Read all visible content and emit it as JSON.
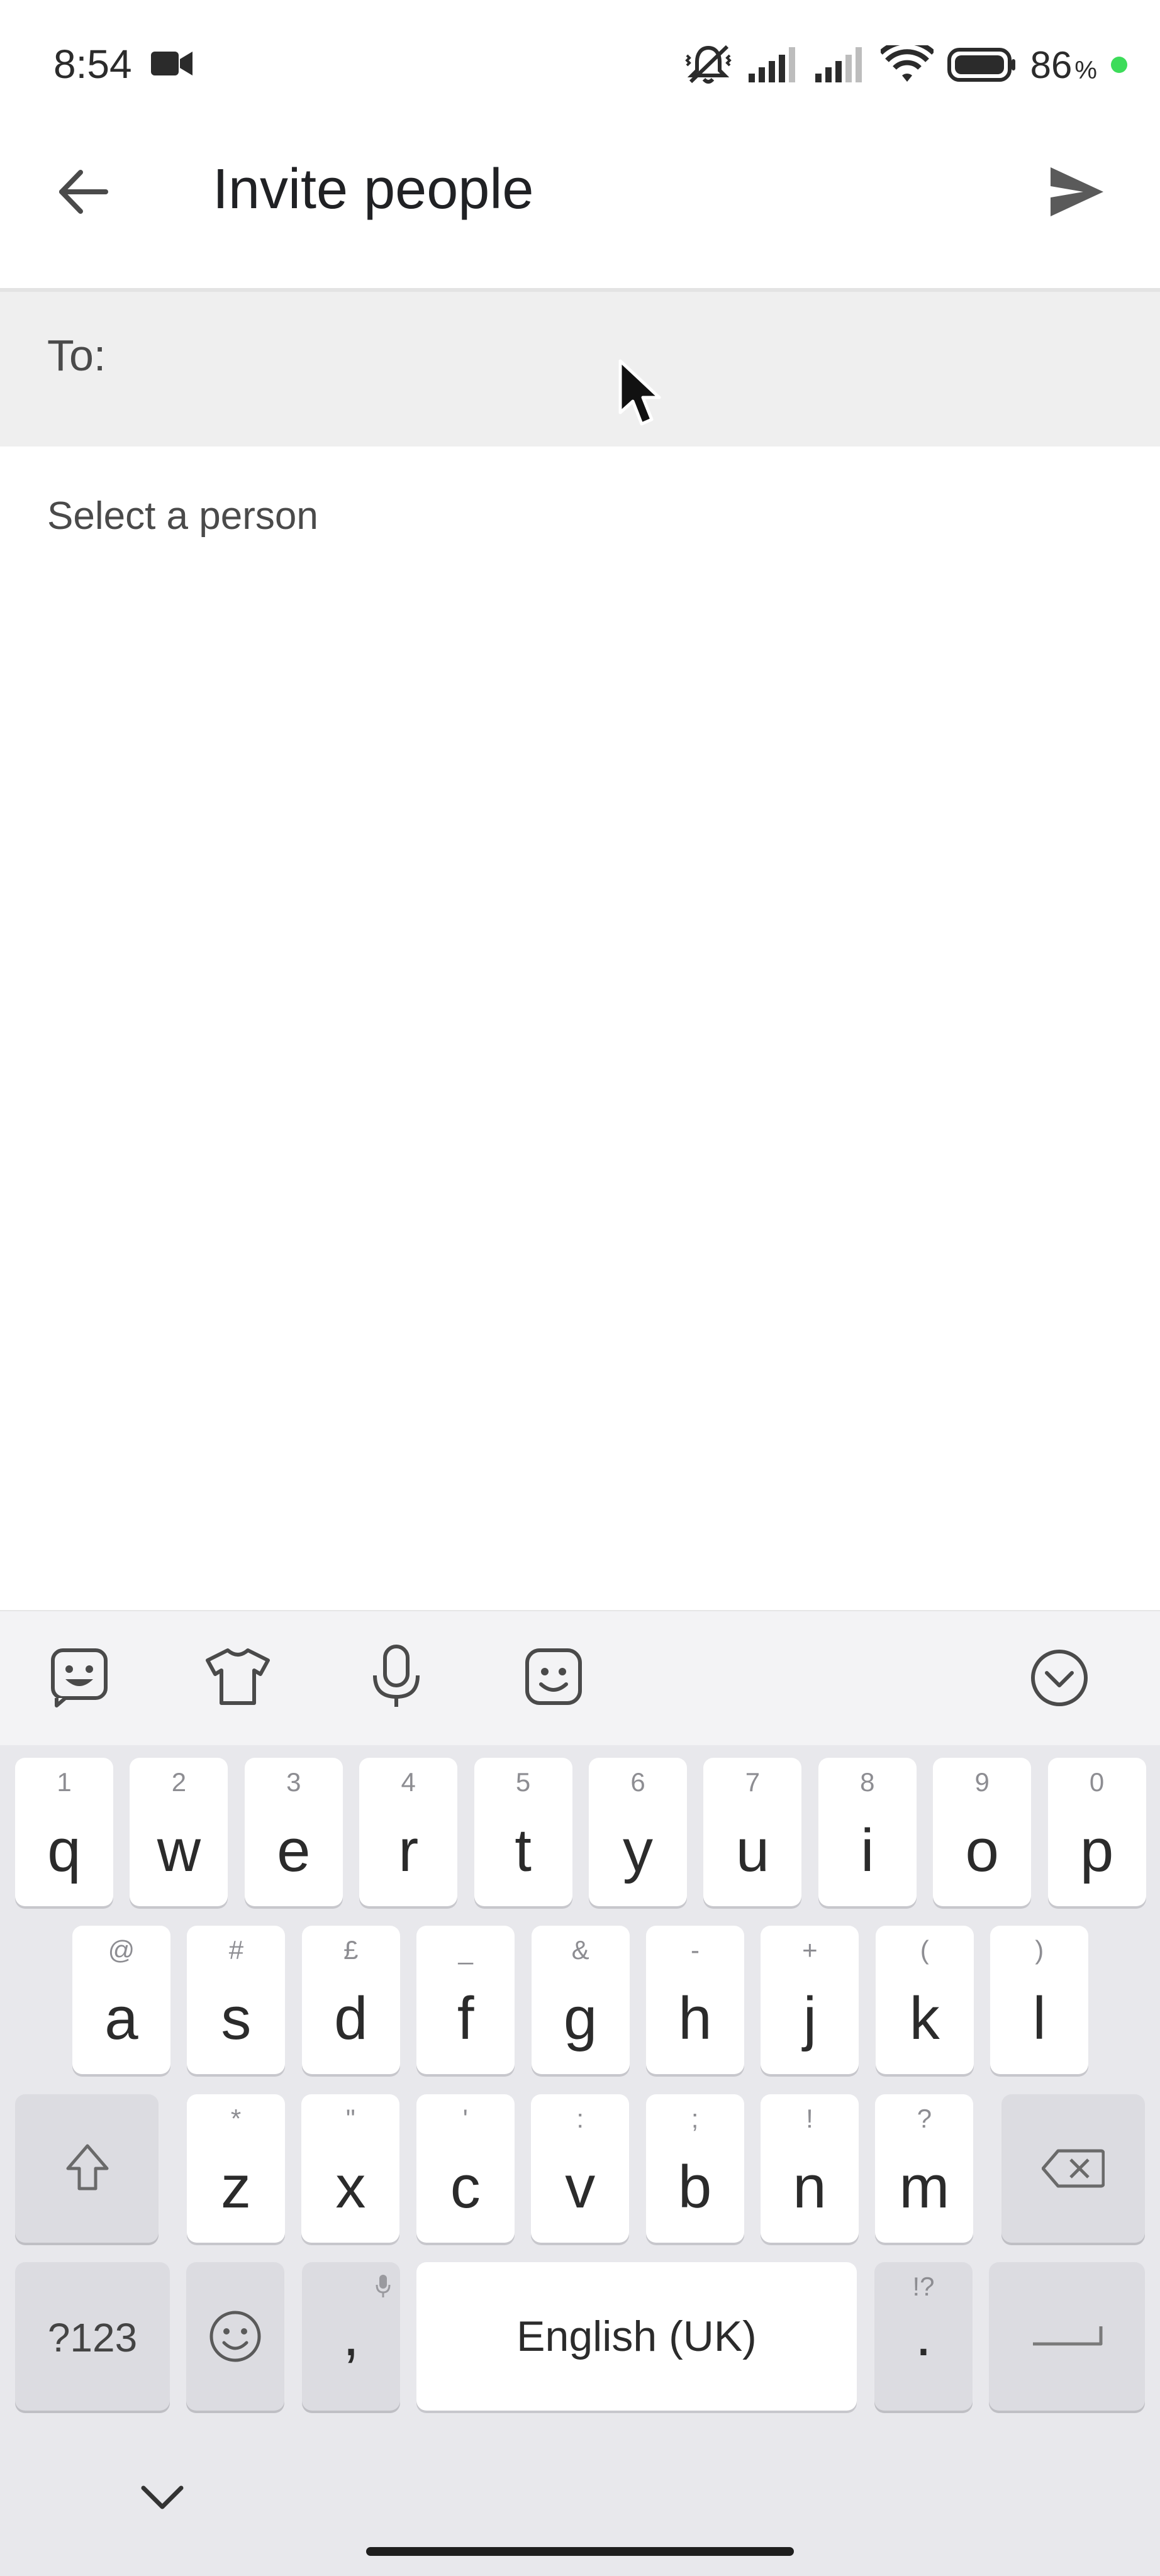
{
  "status_bar": {
    "time": "8:54",
    "battery_level": "86",
    "battery_unit": "%"
  },
  "app_bar": {
    "title": "Invite people"
  },
  "to_field": {
    "label": "To:"
  },
  "content": {
    "section_label": "Select a person"
  },
  "keyboard": {
    "row1": [
      {
        "key": "q",
        "hint": "1"
      },
      {
        "key": "w",
        "hint": "2"
      },
      {
        "key": "e",
        "hint": "3"
      },
      {
        "key": "r",
        "hint": "4"
      },
      {
        "key": "t",
        "hint": "5"
      },
      {
        "key": "y",
        "hint": "6"
      },
      {
        "key": "u",
        "hint": "7"
      },
      {
        "key": "i",
        "hint": "8"
      },
      {
        "key": "o",
        "hint": "9"
      },
      {
        "key": "p",
        "hint": "0"
      }
    ],
    "row2": [
      {
        "key": "a",
        "hint": "@"
      },
      {
        "key": "s",
        "hint": "#"
      },
      {
        "key": "d",
        "hint": "£"
      },
      {
        "key": "f",
        "hint": "_"
      },
      {
        "key": "g",
        "hint": "&"
      },
      {
        "key": "h",
        "hint": "-"
      },
      {
        "key": "j",
        "hint": "+"
      },
      {
        "key": "k",
        "hint": "("
      },
      {
        "key": "l",
        "hint": ")"
      }
    ],
    "row3": [
      {
        "key": "z",
        "hint": "*"
      },
      {
        "key": "x",
        "hint": "\""
      },
      {
        "key": "c",
        "hint": "'"
      },
      {
        "key": "v",
        "hint": ":"
      },
      {
        "key": "b",
        "hint": ";"
      },
      {
        "key": "n",
        "hint": "!"
      },
      {
        "key": "m",
        "hint": "?"
      }
    ],
    "symbols_label": "?123",
    "comma": ",",
    "space_label": "English (UK)",
    "period": ".",
    "period_hint": "!?"
  },
  "colors": {
    "accent_green": "#3ddc5a",
    "field_bg": "#efefef",
    "keyboard_bg": "#e8e8ec"
  }
}
